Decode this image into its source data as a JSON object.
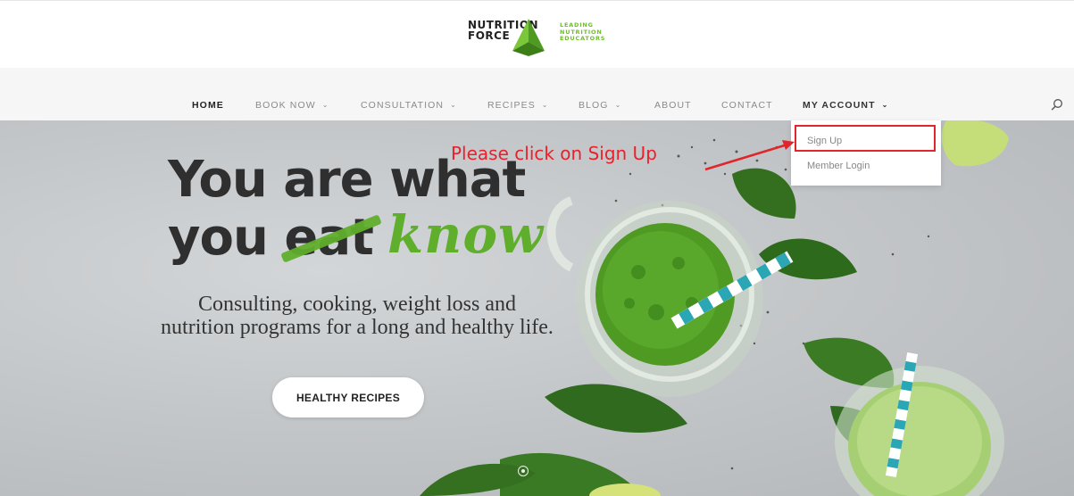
{
  "logo": {
    "name_line1": "NUTRITION",
    "name_line2": "FORCE",
    "tagline": [
      "LEADING",
      "NUTRITION",
      "EDUCATORS"
    ]
  },
  "nav": {
    "items": [
      {
        "label": "HOME",
        "has_dropdown": false
      },
      {
        "label": "BOOK NOW",
        "has_dropdown": true
      },
      {
        "label": "CONSULTATION",
        "has_dropdown": true
      },
      {
        "label": "RECIPES",
        "has_dropdown": true
      },
      {
        "label": "BLOG",
        "has_dropdown": true
      },
      {
        "label": "ABOUT",
        "has_dropdown": false
      },
      {
        "label": "CONTACT",
        "has_dropdown": false
      },
      {
        "label": "MY ACCOUNT",
        "has_dropdown": true
      }
    ],
    "search_icon": "search-icon"
  },
  "account_menu": {
    "items": [
      "Sign Up",
      "Member Login"
    ]
  },
  "hero": {
    "headline_line1": "You are what",
    "headline_you": "you",
    "headline_struck": "eat",
    "headline_replacement": "know",
    "subtitle": "Consulting, cooking, weight loss and nutrition programs for a long and healthy life.",
    "cta_label": "HEALTHY RECIPES"
  },
  "annotation": {
    "text": "Please click on Sign Up",
    "color": "#e8212b"
  },
  "colors": {
    "brand_green": "#5fae2c",
    "annotation_red": "#e0262b"
  }
}
